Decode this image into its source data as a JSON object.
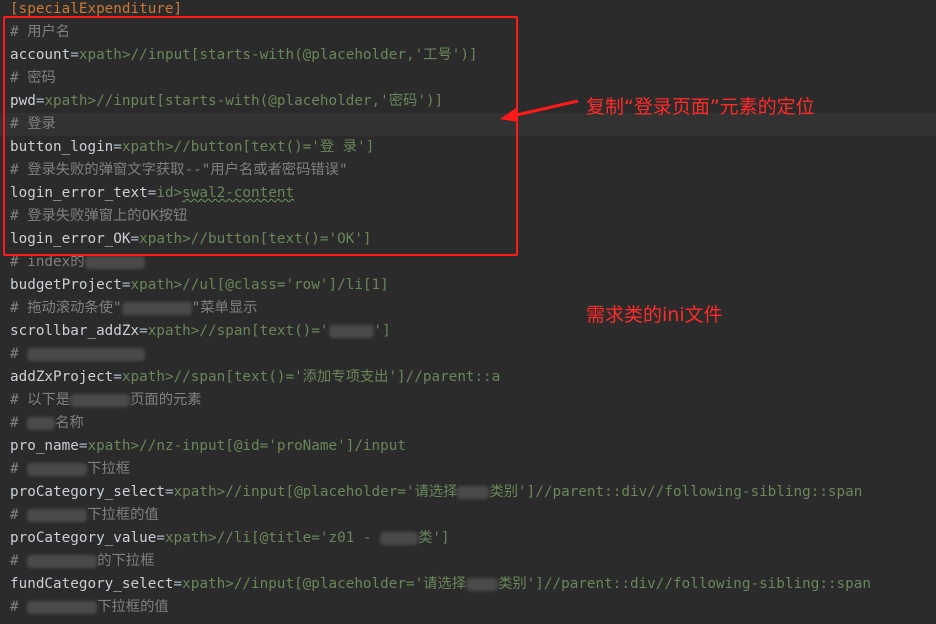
{
  "section_header": "[specialExpenditure]",
  "lines": [
    {
      "comment": "# 用户名"
    },
    {
      "key": "account",
      "eq": "=",
      "prefix": "xpath>",
      "value": "//input[starts-with(@placeholder,'工号')]"
    },
    {
      "comment": "# 密码"
    },
    {
      "key": "pwd",
      "eq": "=",
      "prefix": "xpath>",
      "value": "//input[starts-with(@placeholder,'密码')]"
    },
    {
      "comment": "# 登录"
    },
    {
      "key": "button_login",
      "eq": "=",
      "prefix": "xpath>",
      "value": "//button[text()='登 录']"
    },
    {
      "comment": "# 登录失败的弹窗文字获取--\"用户名或者密码错误\""
    },
    {
      "key": "login_error_text",
      "eq": "=",
      "prefix": "id>",
      "value": "swal2-content"
    },
    {
      "comment": "# 登录失败弹窗上的OK按钮"
    },
    {
      "key": "login_error_OK",
      "eq": "=",
      "prefix": "xpath>",
      "value": "//button[text()='OK']"
    },
    {
      "comment": "# index的"
    },
    {
      "key": "budgetProject",
      "eq": "=",
      "prefix": "xpath>",
      "value": "//ul[@class='row']/li[1]"
    },
    {
      "comment_a": "# 拖动滚动条使\"",
      "comment_b": "\"菜单显示"
    },
    {
      "key": "scrollbar_addZx",
      "eq": "=",
      "prefix": "xpath>",
      "value_a": "//span[text()='",
      "value_b": "']"
    },
    {
      "comment": "# "
    },
    {
      "key": "addZxProject",
      "eq": "=",
      "prefix": "xpath>",
      "value": "//span[text()='添加专项支出']//parent::a"
    },
    {
      "comment_a": "# 以下是",
      "comment_b": "页面的元素"
    },
    {
      "comment_a": "# ",
      "comment_b": "名称"
    },
    {
      "key": "pro_name",
      "eq": "=",
      "prefix": "xpath>",
      "value": "//nz-input[@id='proName']/input"
    },
    {
      "comment_a": "# ",
      "comment_b": "下拉框"
    },
    {
      "key": "proCategory_select",
      "eq": "=",
      "prefix": "xpath>",
      "value_a": "//input[@placeholder='请选择",
      "value_b": "类别']//parent::div//following-sibling::span"
    },
    {
      "comment_a": "# ",
      "comment_b": "下拉框的值"
    },
    {
      "key": "proCategory_value",
      "eq": "=",
      "prefix": "xpath>",
      "value_a": "//li[@title='z01 - ",
      "value_b": "类']"
    },
    {
      "comment_a": "# ",
      "comment_b": "的下拉框"
    },
    {
      "key": "fundCategory_select",
      "eq": "=",
      "prefix": "xpath>",
      "value_a": "//input[@placeholder='请选择",
      "value_b": "类别']//parent::div//following-sibling::span"
    },
    {
      "comment_a": "# ",
      "comment_b": "下拉框的值"
    }
  ],
  "annotations": {
    "copy_locator": "复制“登录页面”元素的定位",
    "ini_file": "需求类的ini文件"
  },
  "colors": {
    "background": "#2b2b2b",
    "comment": "#808080",
    "string_value": "#6a8759",
    "key": "#cbd0d6",
    "section": "#cc7832",
    "annotation_red": "#ff1a1a"
  }
}
